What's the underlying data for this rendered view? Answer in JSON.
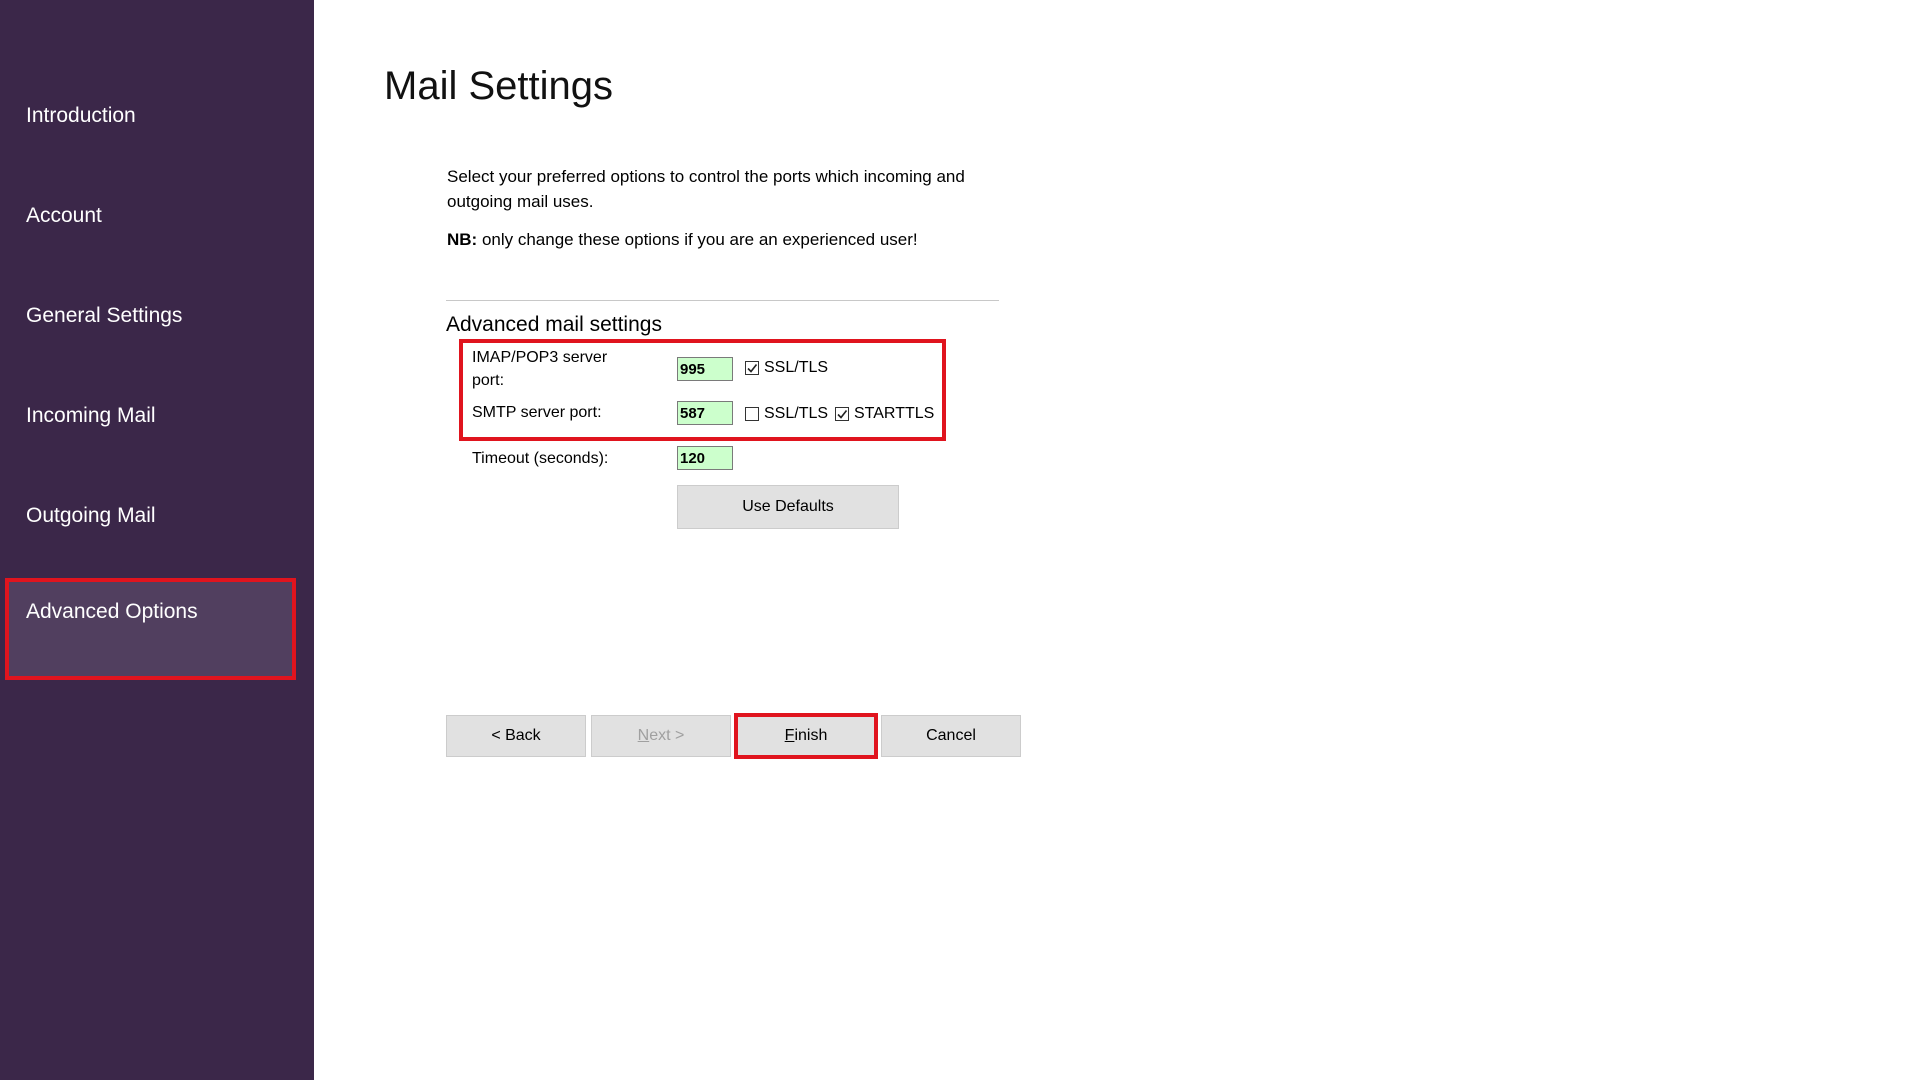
{
  "sidebar": {
    "items": [
      {
        "label": "Introduction"
      },
      {
        "label": "Account"
      },
      {
        "label": "General Settings"
      },
      {
        "label": "Incoming Mail"
      },
      {
        "label": "Outgoing Mail"
      },
      {
        "label": "Advanced Options",
        "selected": true
      }
    ]
  },
  "page": {
    "title": "Mail Settings",
    "intro": "Select your preferred options to control the ports which incoming and outgoing mail uses.",
    "note_bold": "NB:",
    "note_text": " only change these options if you are an experienced user!"
  },
  "advanced": {
    "section_title": "Advanced mail settings",
    "imap_label": "IMAP/POP3 server port:",
    "imap_port": "995",
    "imap_ssl_label": "SSL/TLS",
    "imap_ssl_checked": true,
    "smtp_label": "SMTP server port:",
    "smtp_port": "587",
    "smtp_ssl_label": "SSL/TLS",
    "smtp_ssl_checked": false,
    "smtp_starttls_label": "STARTTLS",
    "smtp_starttls_checked": true,
    "timeout_label": "Timeout (seconds):",
    "timeout_value": "120",
    "use_defaults_label": "Use Defaults"
  },
  "buttons": {
    "back": "< Back",
    "next_mnemonic": "N",
    "next_rest": "ext >",
    "finish_mnemonic": "F",
    "finish_rest": "inish",
    "cancel": "Cancel"
  },
  "colors": {
    "sidebar_bg": "#3b2749",
    "sidebar_selected_bg": "#513f5f",
    "highlight_red": "#e0141e",
    "input_bg": "#ccffcc",
    "button_bg": "#e1e1e1"
  }
}
